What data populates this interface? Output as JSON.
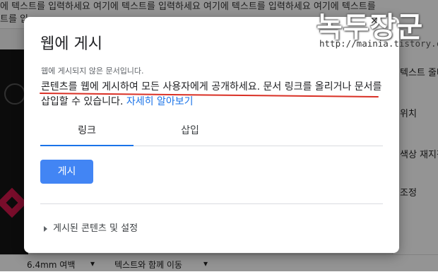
{
  "background": {
    "top_line_1": "에 텍스트를 입력하세요 여기에 텍스트를 입력하세요 여기에 텍스트를 입력하세요 여기에 텍스트를",
    "top_line_2": "트를 입",
    "right_panel_items": [
      "텍스트 줄바",
      "위치",
      "색상 재지정",
      "조정"
    ],
    "bottom_toolbar": {
      "margin_value": "6.4mm 여백",
      "wrap_option": "텍스트와 함께 이동"
    }
  },
  "watermark": {
    "title": "녹두장군",
    "url": "http://mainia.tistory.com"
  },
  "dialog": {
    "title": "웹에 게시",
    "status": "웹에 게시되지 않은 문서입니다.",
    "description": "콘텐츠를 웹에 게시하여 모든 사용자에게 공개하세요. 문서 링크를 올리거나 문서를 삽입할 수 있습니다.",
    "learn_more": "자세히 알아보기",
    "tabs": [
      {
        "label": "링크",
        "active": true
      },
      {
        "label": "삽입",
        "active": false
      }
    ],
    "publish_button": "게시",
    "published_settings": "게시된 콘텐츠 및 설정"
  },
  "colors": {
    "accent": "#1a73e8",
    "button": "#4285f4",
    "annotation": "#d93025"
  }
}
